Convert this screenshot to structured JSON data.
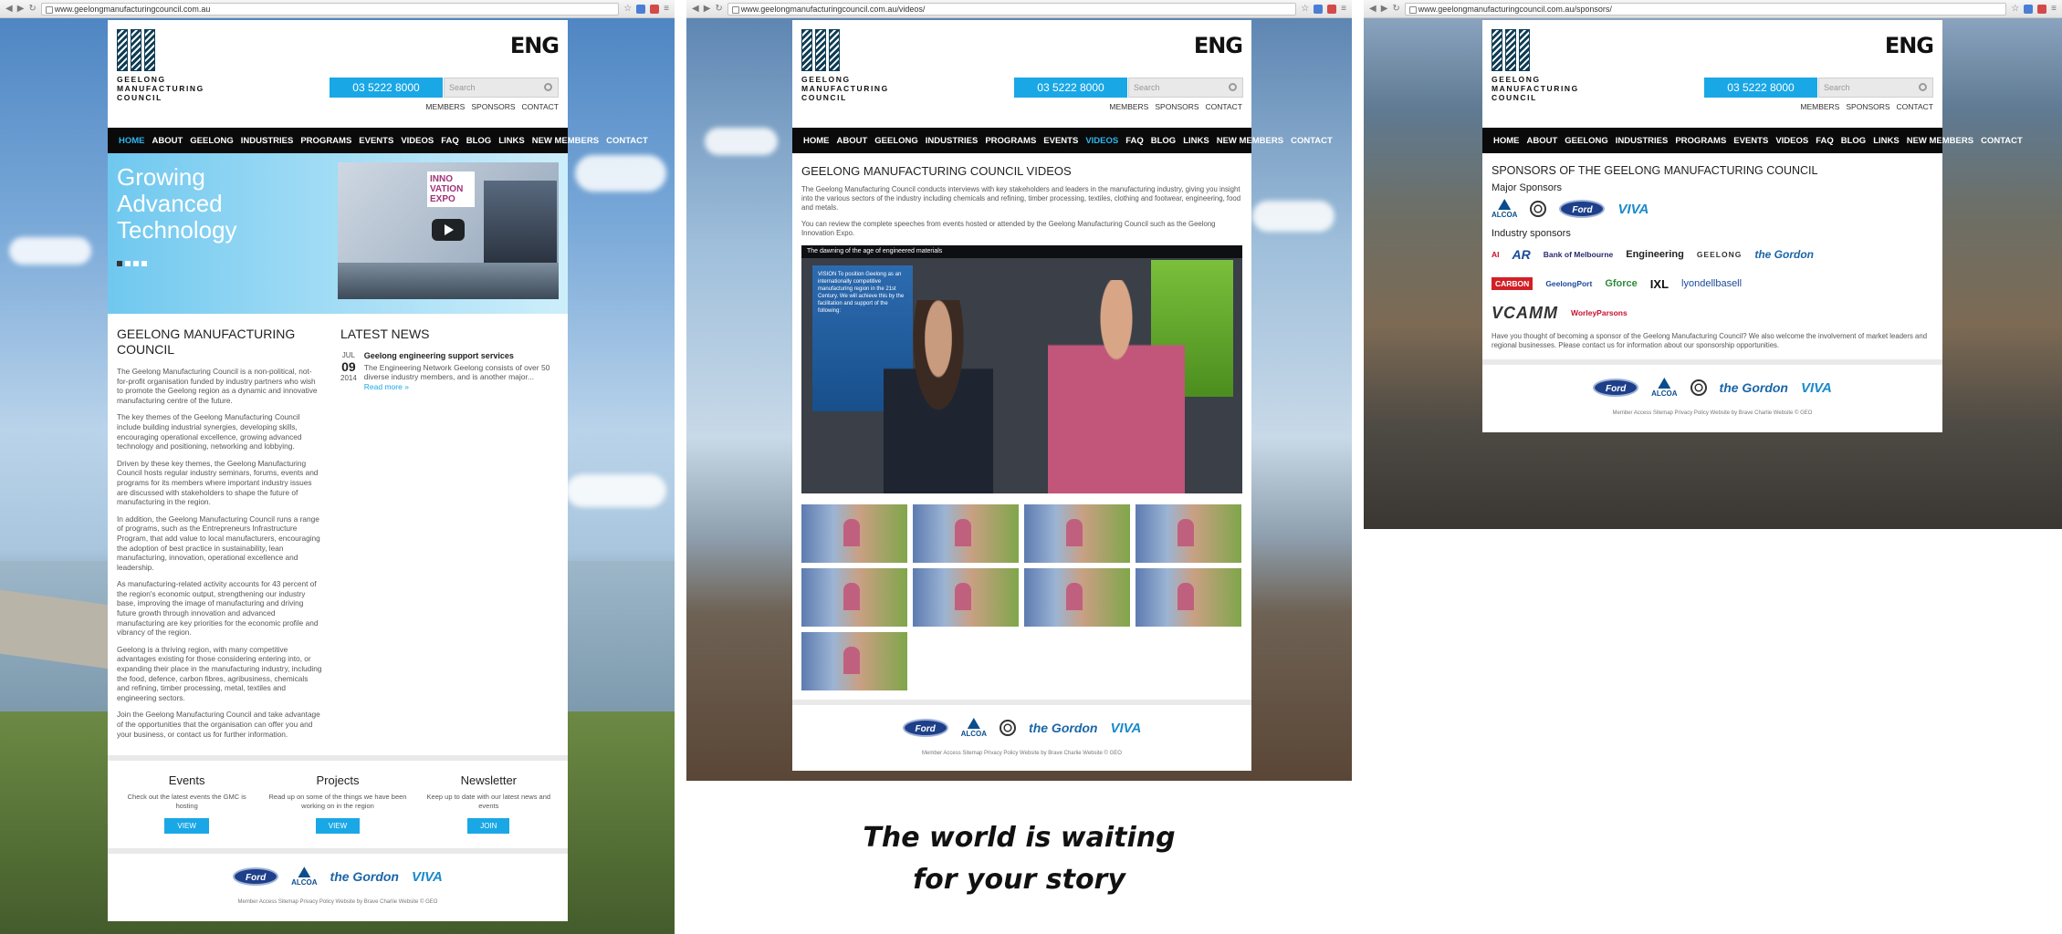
{
  "shots": [
    {
      "url": "www.geelongmanufacturingcouncil.com.au"
    },
    {
      "url": "www.geelongmanufacturingcouncil.com.au/videos/"
    },
    {
      "url": "www.geelongmanufacturingcouncil.com.au/sponsors/"
    }
  ],
  "brand": {
    "logo_lines": [
      "GEELONG",
      "MANUFACTURING",
      "COUNCIL"
    ],
    "eng_logo": "ENG",
    "phone": "03 5222 8000",
    "search_placeholder": "Search",
    "top_links": [
      "MEMBERS",
      "SPONSORS",
      "CONTACT"
    ],
    "accent": "#1aa7e6"
  },
  "menu": [
    "HOME",
    "ABOUT",
    "GEELONG",
    "INDUSTRIES",
    "PROGRAMS",
    "EVENTS",
    "VIDEOS",
    "FAQ",
    "BLOG",
    "LINKS",
    "NEW MEMBERS",
    "CONTACT"
  ],
  "home": {
    "hero_title": "Growing Advanced Technology",
    "hero_video_badge": "INNO VATION EXPO",
    "intro_heading": "GEELONG MANUFACTURING COUNCIL",
    "paragraphs": [
      "The Geelong Manufacturing Council is a non-political, not-for-profit organisation funded by industry partners who wish to promote the Geelong region as a dynamic and innovative manufacturing centre of the future.",
      "The key themes of the Geelong Manufacturing Council include building industrial synergies, developing skills, encouraging operational excellence, growing advanced technology and positioning, networking and lobbying.",
      "Driven by these key themes, the Geelong Manufacturing Council hosts regular industry seminars, forums, events and programs for its members where important industry issues are discussed with stakeholders to shape the future of manufacturing in the region.",
      "In addition, the Geelong Manufacturing Council runs a range of programs, such as the Entrepreneurs Infrastructure Program, that add value to local manufacturers, encouraging the adoption of best practice in sustainability, lean manufacturing, innovation, operational excellence and leadership.",
      "As manufacturing-related activity accounts for 43 percent of the region's economic output, strengthening our industry base, improving the image of manufacturing and driving future growth through innovation and advanced manufacturing are key priorities for the economic profile and vibrancy of the region.",
      "Geelong is a thriving region, with many competitive advantages existing for those considering entering into, or expanding their place in the manufacturing industry, including the food, defence, carbon fibres, agribusiness, chemicals and refining, timber processing, metal, textiles and engineering sectors.",
      "Join the Geelong Manufacturing Council and take advantage of the opportunities that the organisation can offer you and your business, or contact us for further information."
    ],
    "news_heading": "LATEST NEWS",
    "news_month": "JUL",
    "news_day": "09",
    "news_year": "2014",
    "news_title": "Geelong engineering support services",
    "news_excerpt": "The Engineering Network Geelong consists of over 50 diverse industry members, and is another major...",
    "news_more": "Read more »",
    "promos": [
      {
        "title": "Events",
        "text": "Check out the latest events the GMC is hosting",
        "button": "VIEW"
      },
      {
        "title": "Projects",
        "text": "Read up on some of the things we have been working on in the region",
        "button": "VIEW"
      },
      {
        "title": "Newsletter",
        "text": "Keep up to date with our latest news and events",
        "button": "JOIN"
      }
    ]
  },
  "videos": {
    "heading": "GEELONG MANUFACTURING COUNCIL VIDEOS",
    "p1": "The Geelong Manufacturing Council conducts interviews with key stakeholders and leaders in the manufacturing industry, giving you insight into the various sectors of the industry including chemicals and refining, timber processing, textiles, clothing and footwear, engineering, food and metals.",
    "p2": "You can review the complete speeches from events hosted or attended by the Geelong Manufacturing Council such as the Geelong Innovation Expo.",
    "video_caption": "The dawning of the age of engineered materials",
    "poster_text": "VISION To position Geelong as an internationally competitive manufacturing region in the 21st Century. We will achieve this by the facilitation and support of the following:"
  },
  "sponsors": {
    "heading": "SPONSORS OF THE GEELONG MANUFACTURING COUNCIL",
    "major_label": "Major Sponsors",
    "industry_label": "Industry sponsors",
    "industry_row1": [
      "AI",
      "AR",
      "Bank of Melbourne",
      "Engineering",
      "GEELONG",
      "the Gordon"
    ],
    "industry_row2": [
      "CARBON",
      "GeelongPort",
      "Gforce",
      "IXL",
      "lyondellbasell"
    ],
    "industry_row3": [
      "VCAMM",
      "WorleyParsons"
    ],
    "closing": "Have you thought of becoming a sponsor of the Geelong Manufacturing Council? We also welcome the involvement of market leaders and regional businesses. Please contact us for information about our sponsorship opportunities."
  },
  "footer": {
    "ford": "Ford",
    "alcoa": "ALCOA",
    "gordon": "the Gordon",
    "viva": "VIVA",
    "fine": "Member Access   Sitemap   Privacy Policy   Website by Brave Charlie   Website © GEO"
  },
  "tagline": [
    "The world is waiting",
    "for your story"
  ]
}
